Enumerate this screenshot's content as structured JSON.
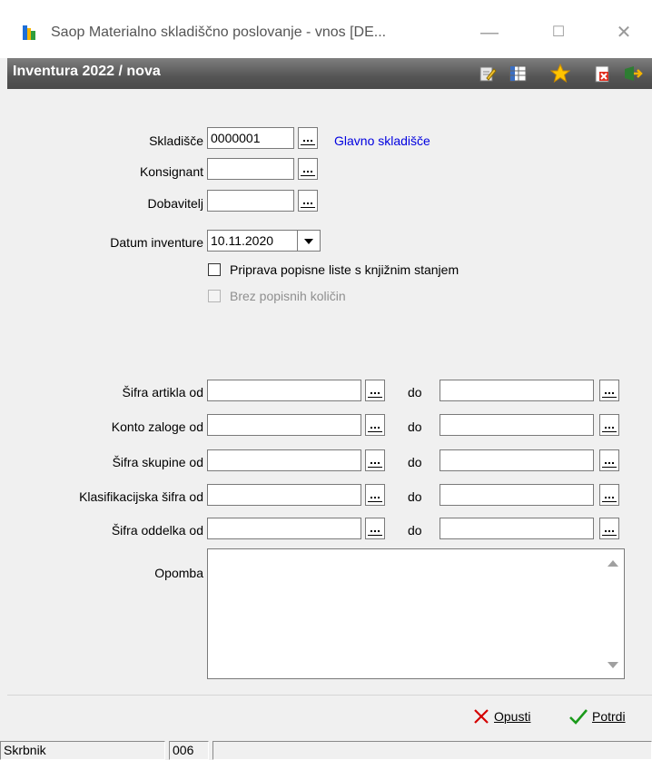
{
  "window": {
    "title": "Saop Materialno skladiščno poslovanje - vnos [DE...",
    "minimize_glyph": "—",
    "maximize_glyph": "☐",
    "close_glyph": "✕"
  },
  "header": {
    "title": "Inventura 2022 / nova",
    "toolbar_icons": [
      "edit-icon",
      "grid-icon",
      "star-icon",
      "delete-icon",
      "exit-icon"
    ]
  },
  "form": {
    "skladisce": {
      "label": "Skladišče",
      "value": "0000001",
      "name": "Glavno skladišče"
    },
    "konsignant": {
      "label": "Konsignant",
      "value": ""
    },
    "dobavitelj": {
      "label": "Dobavitelj",
      "value": ""
    },
    "datum": {
      "label": "Datum inventure",
      "value": "10.11.2020"
    },
    "checkbox_priprava": {
      "label": "Priprava popisne liste s knjižnim stanjem",
      "checked": false
    },
    "checkbox_brez": {
      "label": "Brez popisnih količin",
      "checked": false,
      "disabled": true
    },
    "range_separator": "do",
    "ranges": [
      {
        "label": "Šifra artikla od",
        "from": "",
        "to": ""
      },
      {
        "label": "Konto zaloge od",
        "from": "",
        "to": ""
      },
      {
        "label": "Šifra skupine od",
        "from": "",
        "to": ""
      },
      {
        "label": "Klasifikacijska šifra od",
        "from": "",
        "to": ""
      },
      {
        "label": "Šifra oddelka od",
        "from": "",
        "to": ""
      }
    ],
    "opomba": {
      "label": "Opomba",
      "value": ""
    }
  },
  "actions": {
    "cancel_label": "Opusti",
    "confirm_label": "Potrdi"
  },
  "statusbar": {
    "user": "Skrbnik",
    "code": "006",
    "extra": ""
  },
  "colors": {
    "header_bg": "#555555",
    "link_blue": "#0000e0",
    "cancel_red": "#d40000",
    "confirm_green": "#1a9a1a"
  }
}
